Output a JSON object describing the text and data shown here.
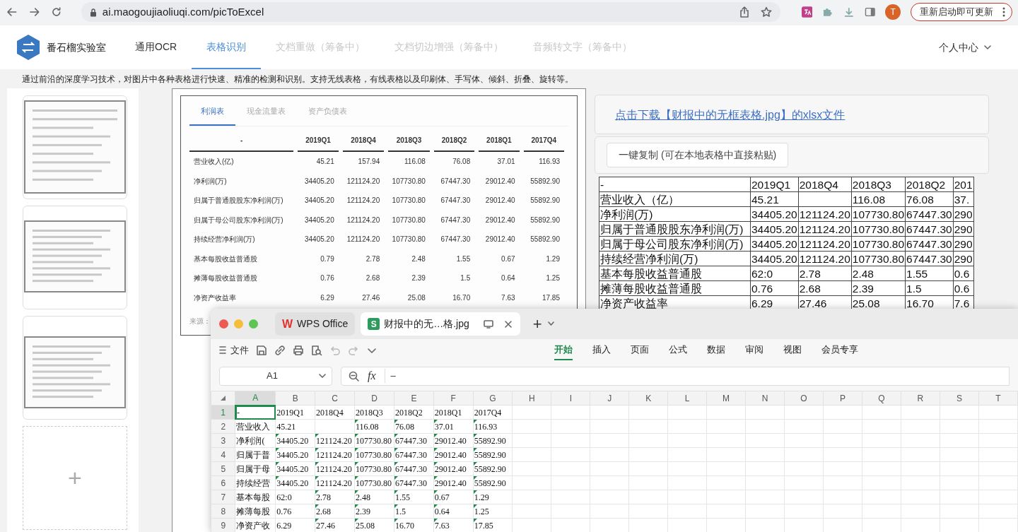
{
  "browser": {
    "url": "ai.maogoujiaoliuqi.com/picToExcel",
    "avatar": "T",
    "update_button": "重新启动即可更新"
  },
  "site": {
    "brand": "番石榴实验室",
    "user_menu": "个人中心",
    "nav": [
      {
        "label": "通用OCR",
        "selected": false,
        "disabled": false
      },
      {
        "label": "表格识别",
        "selected": true,
        "disabled": false
      },
      {
        "label": "文档重做（筹备中）",
        "selected": false,
        "disabled": true
      },
      {
        "label": "文档切边增强（筹备中）",
        "selected": false,
        "disabled": true
      },
      {
        "label": "音频转文字（筹备中）",
        "selected": false,
        "disabled": true
      }
    ]
  },
  "description": "通过前沿的深度学习技术，对图片中各种表格进行快速、精准的检测和识别。支持无线表格，有线表格以及印刷体、手写体、倾斜、折叠、旋转等。",
  "thumbnails": [
    {
      "kind": "picture"
    },
    {
      "kind": "picture"
    },
    {
      "kind": "picture"
    },
    {
      "kind": "add",
      "label": "+"
    }
  ],
  "source_image": {
    "tabs": [
      {
        "label": "利润表",
        "selected": true
      },
      {
        "label": "现金流量表",
        "selected": false
      },
      {
        "label": "资产负债表",
        "selected": false
      }
    ],
    "columns": [
      "-",
      "2019Q1",
      "2018Q4",
      "2018Q3",
      "2018Q2",
      "2018Q1",
      "2017Q4"
    ],
    "rows": [
      [
        "营业收入(亿)",
        "45.21",
        "157.94",
        "116.08",
        "76.08",
        "37.01",
        "116.93"
      ],
      [
        "净利润(万)",
        "34405.20",
        "121124.20",
        "107730.80",
        "67447.30",
        "29012.40",
        "55892.90"
      ],
      [
        "归属于普通股股东净利润(万)",
        "34405.20",
        "121124.20",
        "107730.80",
        "67447.30",
        "29012.40",
        "55892.90"
      ],
      [
        "归属于母公司股东净利润(万)",
        "34405.20",
        "121124.20",
        "107730.80",
        "67447.30",
        "29012.40",
        "55892.90"
      ],
      [
        "持续经营净利润(万)",
        "34405.20",
        "121124.20",
        "107730.80",
        "67447.30",
        "29012.40",
        "55892.90"
      ],
      [
        "基本每股收益普通股",
        "0.79",
        "2.78",
        "2.48",
        "1.55",
        "0.67",
        "1.29"
      ],
      [
        "摊薄每股收益普通股",
        "0.76",
        "2.68",
        "2.39",
        "1.5",
        "0.64",
        "1.25"
      ],
      [
        "净资产收益率",
        "6.29",
        "27.46",
        "25.08",
        "16.70",
        "7.63",
        "17.85"
      ]
    ],
    "footer": "来源："
  },
  "result": {
    "download_link": "点击下载【财报中的无框表格.jpg】的xlsx文件",
    "copy_button": "一键复制 (可在本地表格中直接粘贴)",
    "rows": [
      [
        "-",
        "2019Q1",
        "2018Q4",
        "2018Q3",
        "2018Q2",
        "201"
      ],
      [
        "营业收入（亿）",
        "45.21",
        null,
        "116.08",
        "76.08",
        "37."
      ],
      [
        "净利润(万)",
        "34405.20",
        "121124.20",
        "107730.80",
        "67447.30",
        "290"
      ],
      [
        "归属于普通股股东净利润(万)",
        "34405.20",
        "121124.20",
        "107730.80",
        "67447.30",
        "290"
      ],
      [
        "归属于母公司股东净利润(万)",
        "34405.20",
        "121124.20",
        "107730.80",
        "67447.30",
        "290"
      ],
      [
        "持续经营净利润(万)",
        "34405.20",
        "121124.20",
        "107730.80",
        "67447.30",
        "290"
      ],
      [
        "基本每股收益普通股",
        "62:0",
        "2.78",
        "2.48",
        "1.55",
        "0.6"
      ],
      [
        "摊薄每股收益普通股",
        "0.76",
        "2.68",
        "2.39",
        "1.5",
        "0.6"
      ],
      [
        "净资产收益率",
        "6.29",
        "27.46",
        "25.08",
        "16.70",
        "7.6"
      ]
    ]
  },
  "wps": {
    "tabs": [
      {
        "label": "WPS Office",
        "logo_letter": "W",
        "kind": "home",
        "selected": false
      },
      {
        "label": "财报中的无…格.jpg",
        "logo_letter": "S",
        "kind": "sheet",
        "selected": true
      }
    ],
    "new_tab": "+",
    "file_menu": "文件",
    "ribbon_tabs": [
      {
        "label": "开始",
        "selected": true
      },
      {
        "label": "插入",
        "selected": false
      },
      {
        "label": "页面",
        "selected": false
      },
      {
        "label": "公式",
        "selected": false
      },
      {
        "label": "数据",
        "selected": false
      },
      {
        "label": "审阅",
        "selected": false
      },
      {
        "label": "视图",
        "selected": false
      },
      {
        "label": "会员专享",
        "selected": false
      }
    ],
    "name_box": "A1",
    "function_label": "fx",
    "formula": "–",
    "columns": [
      {
        "label": "A",
        "selected": true
      },
      {
        "label": "B",
        "selected": false
      },
      {
        "label": "C",
        "selected": false
      },
      {
        "label": "D",
        "selected": false
      },
      {
        "label": "E",
        "selected": false
      },
      {
        "label": "F",
        "selected": false
      },
      {
        "label": "G",
        "selected": false
      },
      {
        "label": "H",
        "selected": false
      },
      {
        "label": "I",
        "selected": false
      },
      {
        "label": "J",
        "selected": false
      },
      {
        "label": "K",
        "selected": false
      },
      {
        "label": "L",
        "selected": false
      },
      {
        "label": "M",
        "selected": false
      },
      {
        "label": "N",
        "selected": false
      },
      {
        "label": "O",
        "selected": false
      },
      {
        "label": "P",
        "selected": false
      },
      {
        "label": "Q",
        "selected": false
      },
      {
        "label": "R",
        "selected": false
      },
      {
        "label": "S",
        "selected": false
      },
      {
        "label": "T",
        "selected": false
      }
    ],
    "rows": [
      {
        "number": "1",
        "selected": true,
        "cells": [
          {
            "text": "-",
            "flag": false
          },
          {
            "text": "2019Q1",
            "flag": false
          },
          {
            "text": "2018Q4",
            "flag": false
          },
          {
            "text": "2018Q3",
            "flag": false
          },
          {
            "text": "2018Q2",
            "flag": false
          },
          {
            "text": "2018Q1",
            "flag": false
          },
          {
            "text": "2017Q4",
            "flag": false
          }
        ]
      },
      {
        "number": "2",
        "selected": false,
        "cells": [
          {
            "text": "营业收入",
            "flag": false
          },
          {
            "text": "45.21",
            "flag": false
          },
          {
            "text": null,
            "flag": false
          },
          {
            "text": "116.08",
            "flag": true
          },
          {
            "text": "76.08",
            "flag": true
          },
          {
            "text": "37.01",
            "flag": true
          },
          {
            "text": "116.93",
            "flag": true
          }
        ]
      },
      {
        "number": "3",
        "selected": false,
        "cells": [
          {
            "text": "净利润(",
            "flag": false
          },
          {
            "text": "34405.20",
            "flag": true
          },
          {
            "text": "121124.20",
            "flag": true
          },
          {
            "text": "107730.80",
            "flag": true
          },
          {
            "text": "67447.30",
            "flag": true
          },
          {
            "text": "29012.40",
            "flag": true
          },
          {
            "text": "55892.90",
            "flag": true
          }
        ]
      },
      {
        "number": "4",
        "selected": false,
        "cells": [
          {
            "text": "归属于普",
            "flag": false
          },
          {
            "text": "34405.20",
            "flag": true
          },
          {
            "text": "121124.20",
            "flag": true
          },
          {
            "text": "107730.80",
            "flag": true
          },
          {
            "text": "67447.30",
            "flag": true
          },
          {
            "text": "29012.40",
            "flag": true
          },
          {
            "text": "55892.90",
            "flag": true
          }
        ]
      },
      {
        "number": "5",
        "selected": false,
        "cells": [
          {
            "text": "归属于母",
            "flag": false
          },
          {
            "text": "34405.20",
            "flag": true
          },
          {
            "text": "121124.20",
            "flag": true
          },
          {
            "text": "107730.80",
            "flag": true
          },
          {
            "text": "67447.30",
            "flag": true
          },
          {
            "text": "29012.40",
            "flag": true
          },
          {
            "text": "55892.90",
            "flag": true
          }
        ]
      },
      {
        "number": "6",
        "selected": false,
        "cells": [
          {
            "text": "持续经营",
            "flag": false
          },
          {
            "text": "34405.20",
            "flag": true
          },
          {
            "text": "121124.20",
            "flag": true
          },
          {
            "text": "107730.80",
            "flag": true
          },
          {
            "text": "67447.30",
            "flag": true
          },
          {
            "text": "29012.40",
            "flag": true
          },
          {
            "text": "55892.90",
            "flag": true
          }
        ]
      },
      {
        "number": "7",
        "selected": false,
        "cells": [
          {
            "text": "基本每股",
            "flag": false
          },
          {
            "text": "62:0",
            "flag": false
          },
          {
            "text": "2.78",
            "flag": true
          },
          {
            "text": "2.48",
            "flag": true
          },
          {
            "text": "1.55",
            "flag": true
          },
          {
            "text": "0.67",
            "flag": true
          },
          {
            "text": "1.29",
            "flag": true
          }
        ]
      },
      {
        "number": "8",
        "selected": false,
        "cells": [
          {
            "text": "摊薄每股",
            "flag": false
          },
          {
            "text": "0.76",
            "flag": false
          },
          {
            "text": "2.68",
            "flag": true
          },
          {
            "text": "2.39",
            "flag": true
          },
          {
            "text": "1.5",
            "flag": true
          },
          {
            "text": "0.64",
            "flag": true
          },
          {
            "text": "1.25",
            "flag": true
          }
        ]
      },
      {
        "number": "9",
        "selected": false,
        "cells": [
          {
            "text": "净资产收",
            "flag": false
          },
          {
            "text": "6.29",
            "flag": false
          },
          {
            "text": "27.46",
            "flag": true
          },
          {
            "text": "25.08",
            "flag": true
          },
          {
            "text": "16.70",
            "flag": true
          },
          {
            "text": "7.63",
            "flag": true
          },
          {
            "text": "17.85",
            "flag": true
          }
        ]
      }
    ]
  }
}
